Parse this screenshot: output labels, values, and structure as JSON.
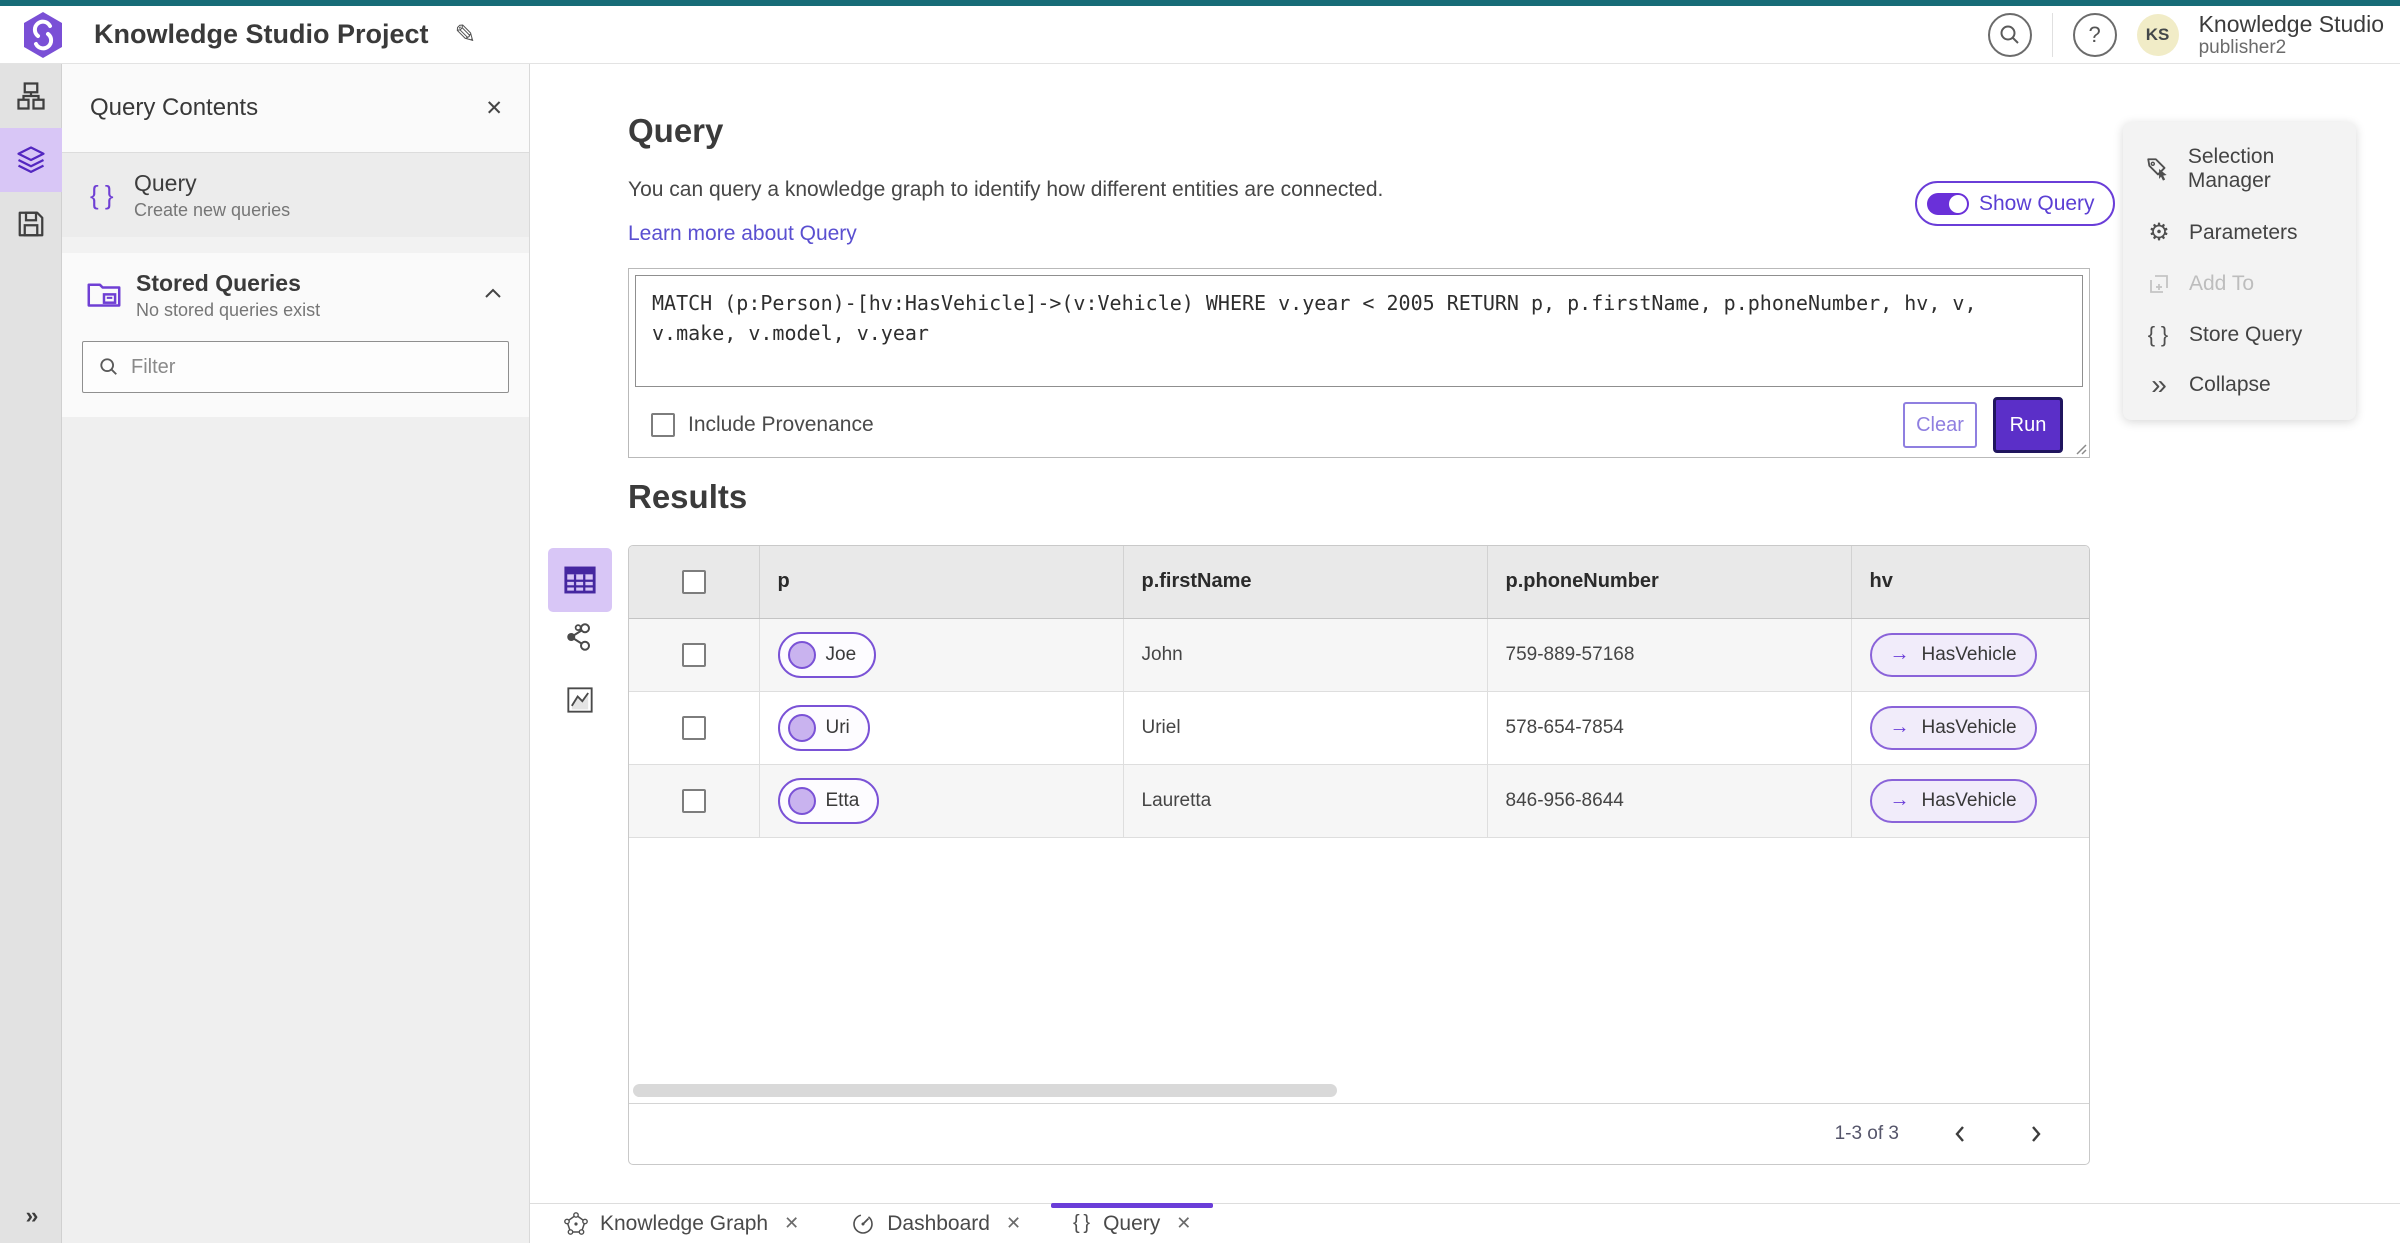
{
  "colors": {
    "accent_purple": "#6a3dd8",
    "run_button_purple": "#5b2fc8",
    "top_strip_teal": "#176c77",
    "selected_tile_lavender": "#d8c6f6",
    "node_circle_fill": "#c9b3ef",
    "rel_pill_fill": "#f1ecfa",
    "avatar_yellow": "#f1ecc7"
  },
  "header": {
    "title": "Knowledge Studio Project",
    "app_name": "Knowledge Studio",
    "user_name": "publisher2",
    "avatar_initials": "KS",
    "icons": [
      "search-icon",
      "help-icon",
      "edit-pencil-icon",
      "app-logo"
    ]
  },
  "left_rail": {
    "items": [
      {
        "icon": "hierarchy-icon",
        "selected": false
      },
      {
        "icon": "layers-icon",
        "selected": true
      },
      {
        "icon": "save-icon",
        "selected": false
      }
    ],
    "expand_icon": "»"
  },
  "left_panel": {
    "title": "Query Contents",
    "query_item": {
      "title": "Query",
      "subtitle": "Create new queries",
      "icon": "curly-braces-icon"
    },
    "stored_queries": {
      "title": "Stored Queries",
      "subtitle": "No stored queries exist",
      "icon": "folder-icon"
    },
    "filter_placeholder": "Filter"
  },
  "query_section": {
    "heading": "Query",
    "description": "You can query a knowledge graph to identify how different entities are connected.",
    "link_label": "Learn more about Query",
    "toggle_label": "Show Query",
    "toggle_state": "on",
    "query_text": "MATCH (p:Person)-[hv:HasVehicle]->(v:Vehicle) WHERE v.year < 2005 RETURN p, p.firstName, p.phoneNumber, hv, v, v.make, v.model, v.year",
    "include_provenance_label": "Include Provenance",
    "include_provenance_checked": false,
    "clear_label": "Clear",
    "run_label": "Run"
  },
  "results": {
    "heading": "Results",
    "view_modes": [
      "table-view-icon",
      "graph-view-icon",
      "chart-view-icon"
    ],
    "active_view": "table-view-icon",
    "columns": [
      "p",
      "p.firstName",
      "p.phoneNumber",
      "hv"
    ],
    "rows": [
      {
        "p": "Joe",
        "first_name": "John",
        "phone": "759-889-57168",
        "hv": "HasVehicle",
        "hv_arrow": "→"
      },
      {
        "p": "Uri",
        "first_name": "Uriel",
        "phone": "578-654-7854",
        "hv": "HasVehicle",
        "hv_arrow": "→"
      },
      {
        "p": "Etta",
        "first_name": "Lauretta",
        "phone": "846-956-8644",
        "hv": "HasVehicle",
        "hv_arrow": "→"
      }
    ],
    "pagination_range": "1-3 of 3"
  },
  "right_panel": {
    "items": [
      {
        "label": "Selection Manager",
        "icon": "selection-manager-icon",
        "disabled": false
      },
      {
        "label": "Parameters",
        "icon": "gear-icon",
        "disabled": false
      },
      {
        "label": "Add To",
        "icon": "add-to-icon",
        "disabled": true
      },
      {
        "label": "Store Query",
        "icon": "curly-braces-icon",
        "disabled": false
      },
      {
        "label": "Collapse",
        "icon": "collapse-icon",
        "disabled": false
      }
    ]
  },
  "bottom_tabs": [
    {
      "label": "Knowledge Graph",
      "icon": "knowledge-graph-icon",
      "active": false
    },
    {
      "label": "Dashboard",
      "icon": "dashboard-gauge-icon",
      "active": false
    },
    {
      "label": "Query",
      "icon": "curly-braces-icon",
      "active": true
    }
  ]
}
